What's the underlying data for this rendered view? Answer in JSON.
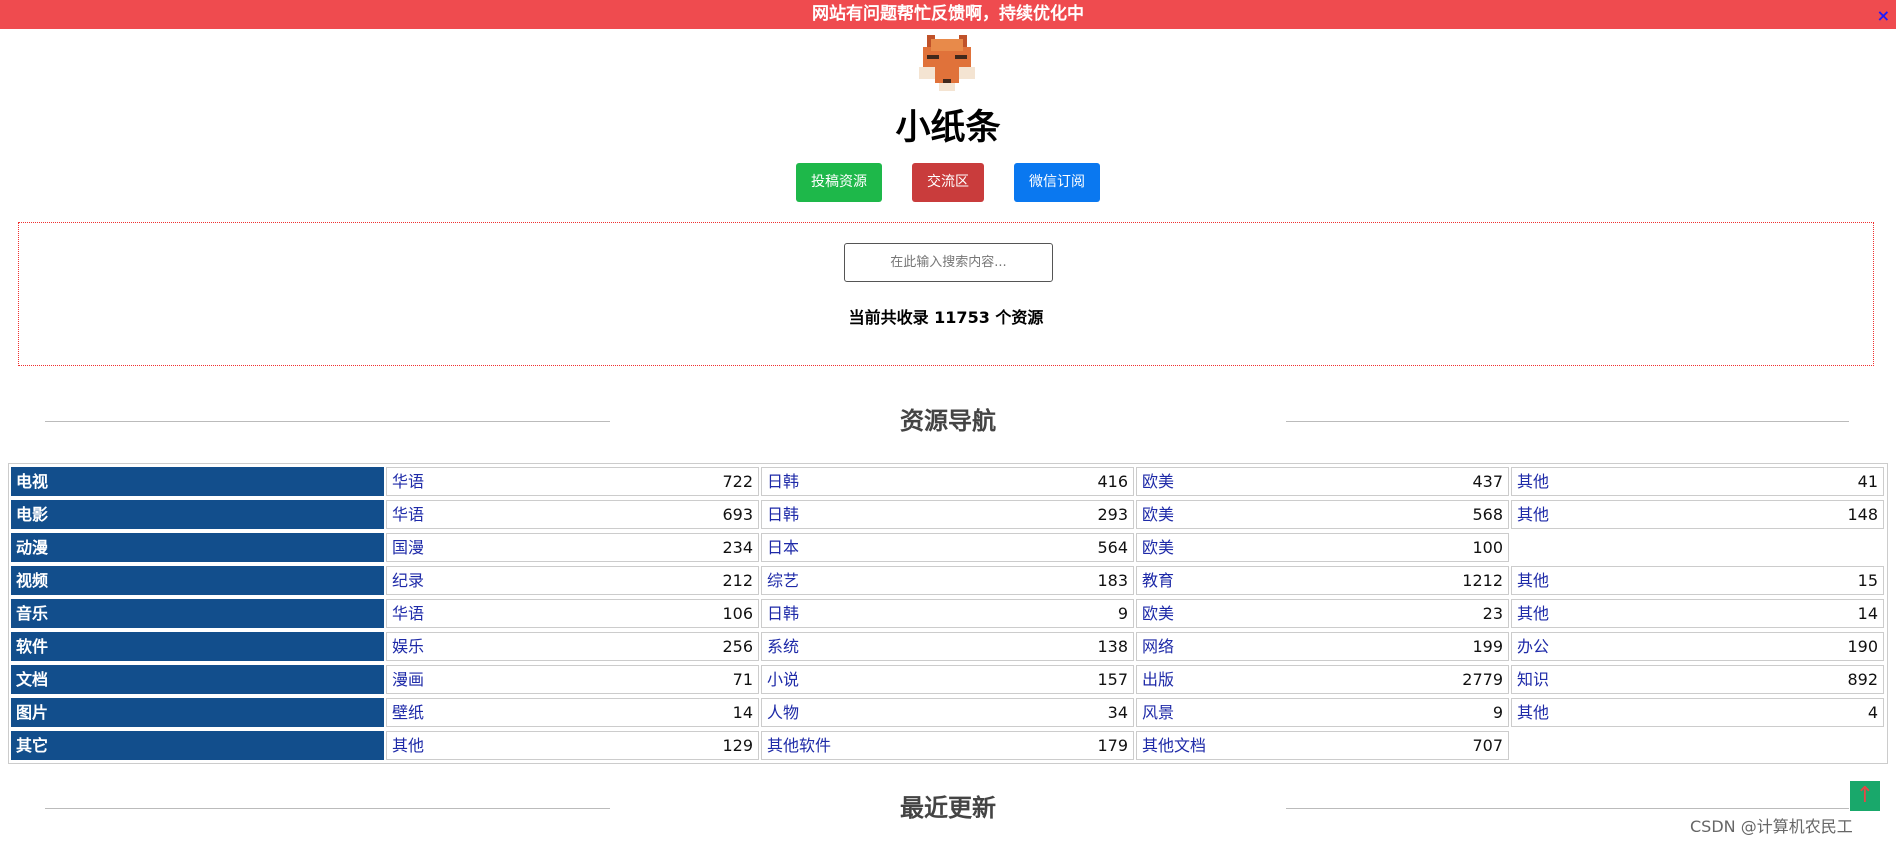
{
  "banner": {
    "text": "网站有问题帮忙反馈啊，持续优化中",
    "close": "×"
  },
  "site": {
    "title": "小纸条"
  },
  "buttons": {
    "submit": "投稿资源",
    "forum": "交流区",
    "wechat": "微信订阅"
  },
  "search": {
    "placeholder": "在此输入搜索内容...",
    "count_text": "当前共收录 11753 个资源"
  },
  "sections": {
    "nav_title": "资源导航",
    "recent_title": "最近更新"
  },
  "nav": [
    {
      "category": "电视",
      "items": [
        {
          "label": "华语",
          "count": "722"
        },
        {
          "label": "日韩",
          "count": "416"
        },
        {
          "label": "欧美",
          "count": "437"
        },
        {
          "label": "其他",
          "count": "41"
        }
      ]
    },
    {
      "category": "电影",
      "items": [
        {
          "label": "华语",
          "count": "693"
        },
        {
          "label": "日韩",
          "count": "293"
        },
        {
          "label": "欧美",
          "count": "568"
        },
        {
          "label": "其他",
          "count": "148"
        }
      ]
    },
    {
      "category": "动漫",
      "items": [
        {
          "label": "国漫",
          "count": "234"
        },
        {
          "label": "日本",
          "count": "564"
        },
        {
          "label": "欧美",
          "count": "100"
        }
      ]
    },
    {
      "category": "视频",
      "items": [
        {
          "label": "纪录",
          "count": "212"
        },
        {
          "label": "综艺",
          "count": "183"
        },
        {
          "label": "教育",
          "count": "1212"
        },
        {
          "label": "其他",
          "count": "15"
        }
      ]
    },
    {
      "category": "音乐",
      "items": [
        {
          "label": "华语",
          "count": "106"
        },
        {
          "label": "日韩",
          "count": "9"
        },
        {
          "label": "欧美",
          "count": "23"
        },
        {
          "label": "其他",
          "count": "14"
        }
      ]
    },
    {
      "category": "软件",
      "items": [
        {
          "label": "娱乐",
          "count": "256"
        },
        {
          "label": "系统",
          "count": "138"
        },
        {
          "label": "网络",
          "count": "199"
        },
        {
          "label": "办公",
          "count": "190"
        }
      ]
    },
    {
      "category": "文档",
      "items": [
        {
          "label": "漫画",
          "count": "71"
        },
        {
          "label": "小说",
          "count": "157"
        },
        {
          "label": "出版",
          "count": "2779"
        },
        {
          "label": "知识",
          "count": "892"
        }
      ]
    },
    {
      "category": "图片",
      "items": [
        {
          "label": "壁纸",
          "count": "14"
        },
        {
          "label": "人物",
          "count": "34"
        },
        {
          "label": "风景",
          "count": "9"
        },
        {
          "label": "其他",
          "count": "4"
        }
      ]
    },
    {
      "category": "其它",
      "items": [
        {
          "label": "其他",
          "count": "129"
        },
        {
          "label": "其他软件",
          "count": "179"
        },
        {
          "label": "其他文档",
          "count": "707"
        }
      ]
    }
  ],
  "watermark": "CSDN @计算机农民工",
  "icons": {
    "logo": "fox-logo-icon",
    "to_top": "arrow-up-icon"
  },
  "colors": {
    "banner": "#ef4b4f",
    "category": "#124e8c",
    "link": "#1e2aa8",
    "submit": "#1eb84a",
    "forum": "#c93c3c",
    "wechat": "#0a78f0"
  }
}
